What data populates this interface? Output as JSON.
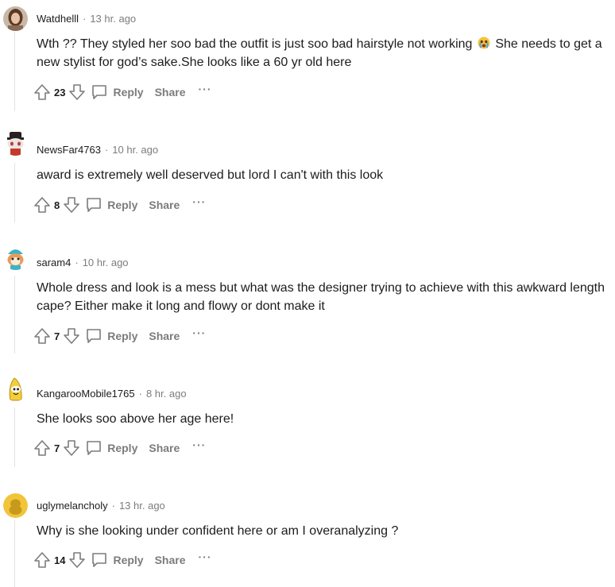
{
  "comments": [
    {
      "username": "Watdhelll",
      "separator": "·",
      "time": "13 hr. ago",
      "text_before_emoji": "Wth ?? They styled her soo bad the outfit is just soo bad hairstyle not working ",
      "emoji": "crying-face-emoji",
      "text_after_emoji": " She needs to get a new stylist for god’s sake.She looks like a 60 yr old here",
      "votes": "23",
      "reply_label": "Reply",
      "share_label": "Share",
      "more_label": "···",
      "avatar": "woman-portrait-avatar"
    },
    {
      "username": "NewsFar4763",
      "separator": "·",
      "time": "10 hr. ago",
      "text": "award is extremely well deserved but lord I can't with this look",
      "votes": "8",
      "reply_label": "Reply",
      "share_label": "Share",
      "more_label": "···",
      "avatar": "snoo-top-hat-avatar"
    },
    {
      "username": "saram4",
      "separator": "·",
      "time": "10 hr. ago",
      "text": "Whole dress and look is a mess but what was the designer trying to achieve with this awkward length cape? Either make it long and flowy or dont make it",
      "votes": "7",
      "reply_label": "Reply",
      "share_label": "Share",
      "more_label": "···",
      "avatar": "teal-hat-snoo-avatar"
    },
    {
      "username": "KangarooMobile1765",
      "separator": "·",
      "time": "8 hr. ago",
      "text": "She looks soo above her age here!",
      "votes": "7",
      "reply_label": "Reply",
      "share_label": "Share",
      "more_label": "···",
      "avatar": "banana-snoo-avatar"
    },
    {
      "username": "uglymelancholy",
      "separator": "·",
      "time": "13 hr. ago",
      "text": "Why is she looking under confident here or am I overanalyzing ?",
      "votes": "14",
      "reply_label": "Reply",
      "share_label": "Share",
      "more_label": "···",
      "avatar": "yellow-default-avatar"
    }
  ],
  "colors": {
    "text": "#1c1c1c",
    "muted": "#7c7c7c",
    "thread_line": "#e3e3e3",
    "avatar_yellow": "#f2c43a"
  }
}
